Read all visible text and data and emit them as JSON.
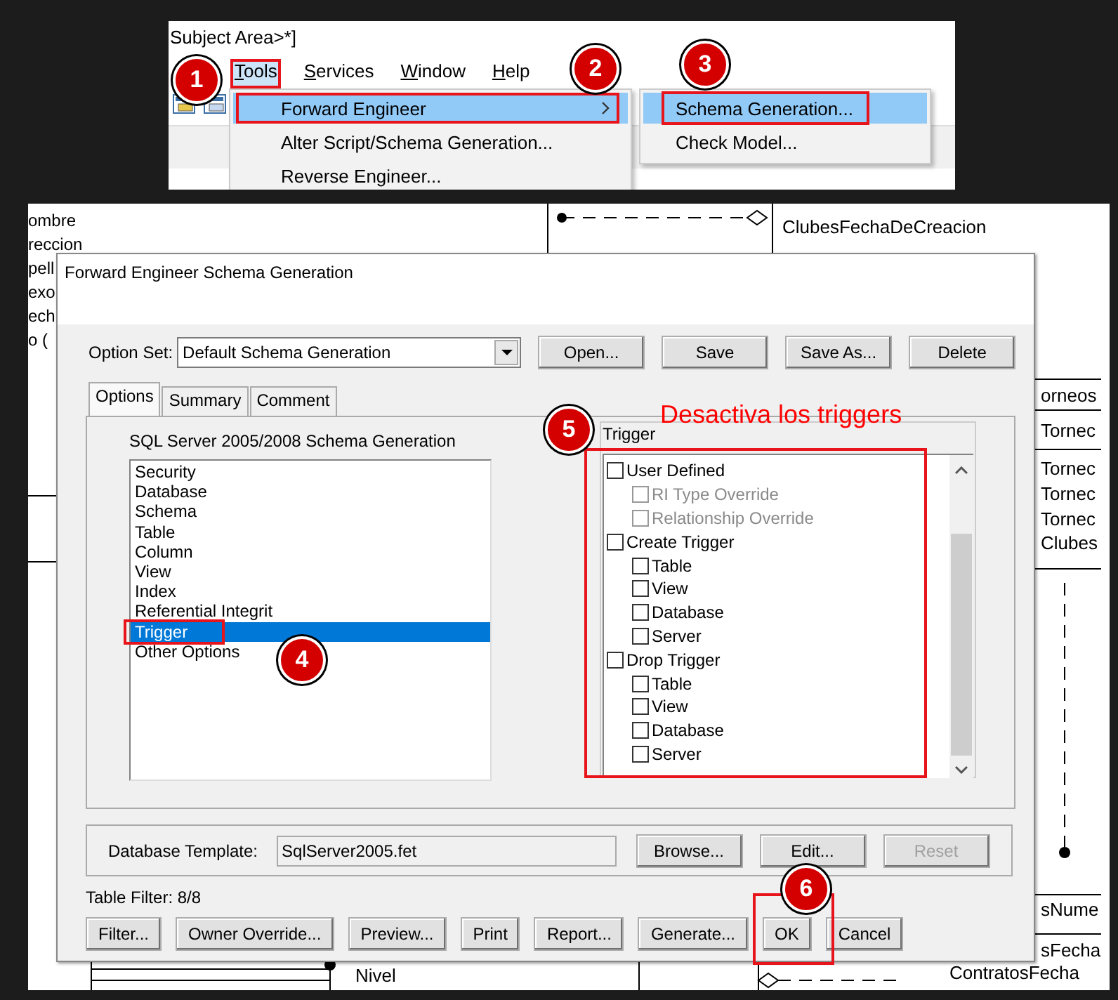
{
  "app": {
    "title": "Subject Area>*]",
    "menus": [
      {
        "label": "Tools",
        "selected": true
      },
      {
        "label": "Services",
        "selected": false
      },
      {
        "label": "Window",
        "selected": false
      },
      {
        "label": "Help",
        "selected": false
      }
    ],
    "menu": [
      {
        "label": "Forward Engineer",
        "selected": true,
        "submenu": true
      },
      {
        "label": "Alter Script/Schema Generation...",
        "selected": false,
        "submenu": false
      },
      {
        "label": "Reverse Engineer...",
        "selected": false,
        "submenu": false
      }
    ],
    "submenu": [
      {
        "label": "Schema Generation...",
        "selected": true
      },
      {
        "label": "Check Model...",
        "selected": false
      }
    ]
  },
  "diagram": {
    "labels": [
      "ombre",
      "reccion",
      "pell",
      "exo",
      "ech",
      "o (",
      "ClubesFechaDeCreacion",
      "orneos",
      "Tornec",
      "Tornec",
      "Tornec",
      "Tornec",
      "Clubes",
      "sNume",
      "sFecha",
      "ContratosFecha",
      "Nivel"
    ]
  },
  "dialog": {
    "title": "Forward Engineer Schema Generation",
    "option_set": {
      "label": "Option Set:",
      "value": "Default Schema Generation"
    },
    "top_buttons": [
      "Open...",
      "Save",
      "Save As...",
      "Delete"
    ],
    "tabs": [
      {
        "label": "Options",
        "selected": true
      },
      {
        "label": "Summary",
        "selected": false
      },
      {
        "label": "Comment",
        "selected": false
      }
    ],
    "options_heading": "SQL Server 2005/2008 Schema Generation",
    "options": [
      {
        "label": "Security",
        "selected": false
      },
      {
        "label": "Database",
        "selected": false
      },
      {
        "label": "Schema",
        "selected": false
      },
      {
        "label": "Table",
        "selected": false
      },
      {
        "label": "Column",
        "selected": false
      },
      {
        "label": "View",
        "selected": false
      },
      {
        "label": "Index",
        "selected": false
      },
      {
        "label": "Referential Integrit",
        "selected": false
      },
      {
        "label": "Trigger",
        "selected": true
      },
      {
        "label": "Other Options",
        "selected": false
      }
    ],
    "trigger": {
      "title": "Trigger",
      "items": [
        {
          "label": "User Defined",
          "checked": false,
          "disabled": false,
          "children": [
            {
              "label": "RI Type Override",
              "checked": false,
              "disabled": true
            },
            {
              "label": "Relationship Override",
              "checked": false,
              "disabled": true
            }
          ]
        },
        {
          "label": "Create Trigger",
          "checked": false,
          "disabled": false,
          "children": [
            {
              "label": "Table",
              "checked": false,
              "disabled": false
            },
            {
              "label": "View",
              "checked": false,
              "disabled": false
            },
            {
              "label": "Database",
              "checked": false,
              "disabled": false
            },
            {
              "label": "Server",
              "checked": false,
              "disabled": false
            }
          ]
        },
        {
          "label": "Drop Trigger",
          "checked": false,
          "disabled": false,
          "children": [
            {
              "label": "Table",
              "checked": false,
              "disabled": false
            },
            {
              "label": "View",
              "checked": false,
              "disabled": false
            },
            {
              "label": "Database",
              "checked": false,
              "disabled": false
            },
            {
              "label": "Server",
              "checked": false,
              "disabled": false
            }
          ]
        }
      ]
    },
    "template": {
      "label": "Database Template:",
      "value": "SqlServer2005.fet",
      "buttons": [
        {
          "label": "Browse...",
          "disabled": false
        },
        {
          "label": "Edit...",
          "disabled": false
        },
        {
          "label": "Reset",
          "disabled": true
        }
      ]
    },
    "table_filter": "Table Filter: 8/8",
    "buttons": [
      "Filter...",
      "Owner Override...",
      "Preview...",
      "Print",
      "Report...",
      "Generate...",
      "OK",
      "Cancel"
    ]
  },
  "annotations": {
    "badges": [
      "1",
      "2",
      "3",
      "4",
      "5",
      "6"
    ],
    "note": "Desactiva los triggers"
  }
}
